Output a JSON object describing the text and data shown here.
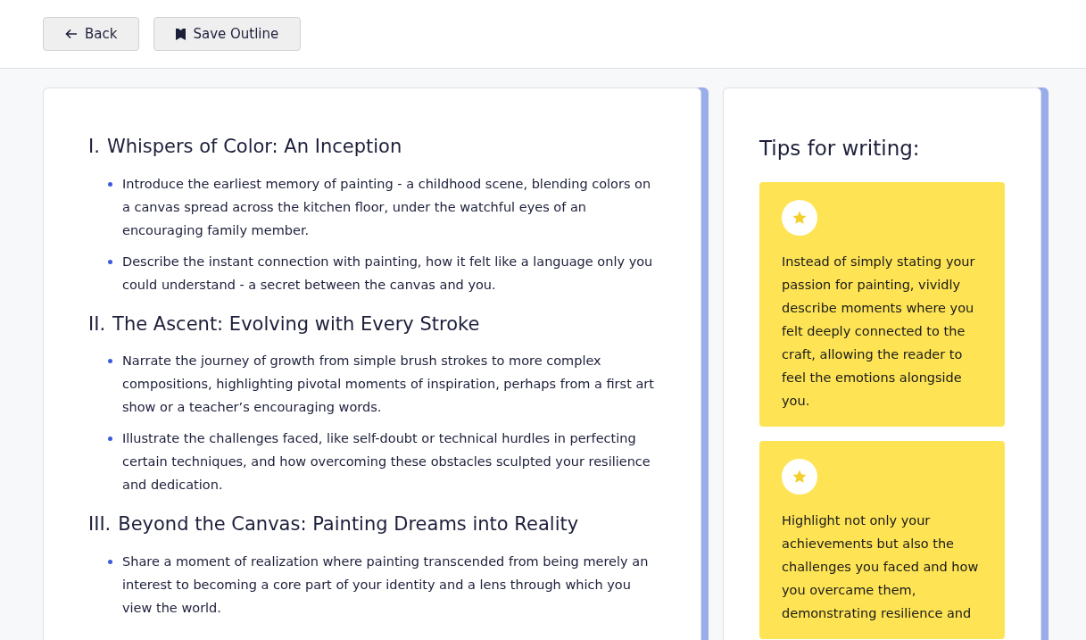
{
  "toolbar": {
    "buttons": [
      {
        "kind": "back",
        "label": "Back"
      },
      {
        "kind": "save",
        "label": "Save Outline"
      }
    ]
  },
  "outline": {
    "sections": [
      {
        "numeral": "I.",
        "title": "Whispers of Color: An Inception",
        "points": [
          "Introduce the earliest memory of painting - a childhood scene, blending colors on a canvas spread across the kitchen floor, under the watchful eyes of an encouraging family member.",
          "Describe the instant connection with painting, how it felt like a language only you could understand - a secret between the canvas and you."
        ]
      },
      {
        "numeral": "II.",
        "title": "The Ascent: Evolving with Every Stroke",
        "points": [
          "Narrate the journey of growth from simple brush strokes to more complex compositions, highlighting pivotal moments of inspiration, perhaps from a first art show or a teacher’s encouraging words.",
          "Illustrate the challenges faced, like self-doubt or technical hurdles in perfecting certain techniques, and how overcoming these obstacles sculpted your resilience and dedication."
        ]
      },
      {
        "numeral": "III.",
        "title": "Beyond the Canvas: Painting Dreams into Reality",
        "points": [
          "Share a moment of realization where painting transcended from being merely an interest to becoming a core part of your identity and a lens through which you view the world."
        ]
      }
    ]
  },
  "tips": {
    "title": "Tips for writing:",
    "items": [
      "Instead of simply stating your passion for painting, vividly describe moments where you felt deeply connected to the craft, allowing the reader to feel the emotions alongside you.",
      "Highlight not only your achievements but also the challenges you faced and how you overcame them, demonstrating resilience and"
    ]
  }
}
